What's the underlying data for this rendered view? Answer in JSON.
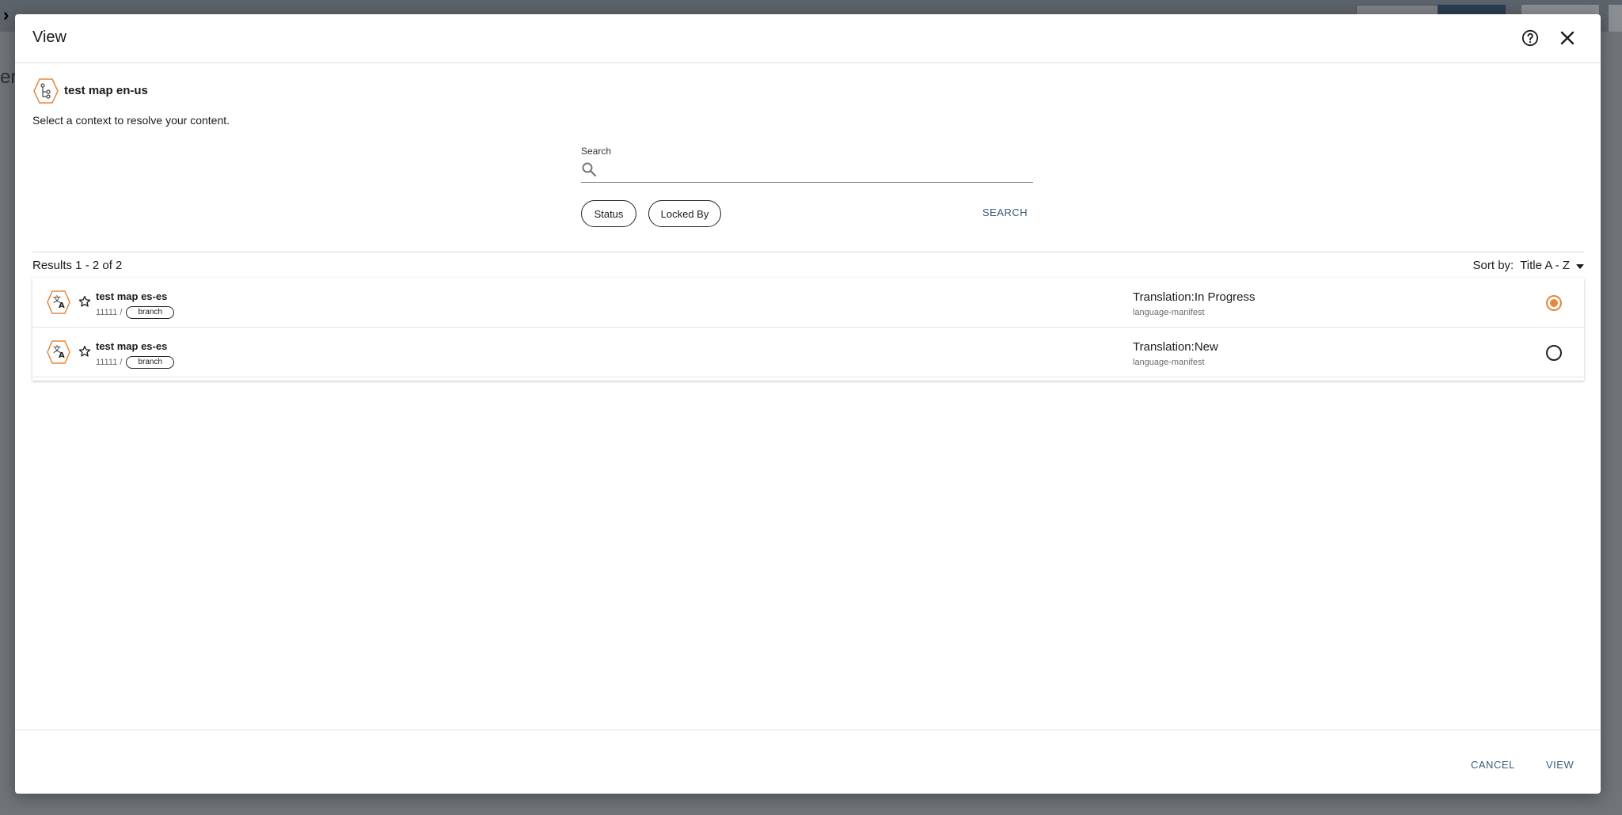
{
  "background": {
    "partial_text": "er"
  },
  "dialog": {
    "title": "View",
    "map": {
      "title": "test map en-us",
      "icon": "map-hierarchy-icon"
    },
    "instruction": "Select a context to resolve your content.",
    "search": {
      "label": "Search",
      "value": "",
      "placeholder": "",
      "filters": [
        "Status",
        "Locked By"
      ],
      "button_label": "SEARCH"
    },
    "results": {
      "count_text": "Results 1 - 2 of 2",
      "sort_label": "Sort by:",
      "sort_value": "Title A - Z"
    },
    "rows": [
      {
        "title": "test map es-es",
        "id": "11111 /",
        "branch": "branch",
        "status": "Translation:In Progress",
        "type": "language-manifest",
        "selected": true
      },
      {
        "title": "test map es-es",
        "id": "11111 /",
        "branch": "branch",
        "status": "Translation:New",
        "type": "language-manifest",
        "selected": false
      }
    ],
    "footer": {
      "cancel_label": "CANCEL",
      "view_label": "VIEW"
    }
  },
  "colors": {
    "accent": "#e8863a",
    "link": "#3d5b78"
  }
}
